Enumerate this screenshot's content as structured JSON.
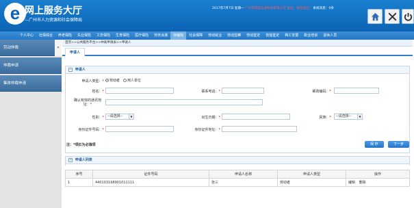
{
  "header": {
    "logo_title": "网上服务大厅",
    "logo_sub": "—广州市人力资源和社会保障局",
    "date_text": "2017年7月7日 星期一",
    "company_text": "广州市新盈信通科技有限公司",
    "link_text": "退出，请您退出！",
    "system_text": "系统消息：0条"
  },
  "nav": {
    "items": [
      "个人中心",
      "社保综合",
      "养老保险",
      "失业保险",
      "工伤保险",
      "生育保险",
      "医疗保险",
      "劳务派遣",
      "仲裁院",
      "社会保障",
      "劳动就业",
      "劳动监察",
      "劳动鉴定",
      "技能鉴定",
      "档工安置",
      "职业培训",
      "退休人员"
    ],
    "active_index": 8
  },
  "sidebar": {
    "items": [
      "劳动仲裁",
      "仲裁申请",
      "集体仲裁申请"
    ],
    "collapse": "«"
  },
  "breadcrumb": "首页>>公共服务平台>>仲裁申请表>>申请人",
  "tab": "申请人",
  "form": {
    "section_title": "申请人",
    "applicant_type_label": "申请人类型：",
    "applicant_type_options": [
      "劳动者",
      "用人单位"
    ],
    "name_label": "姓名：",
    "phone_label": "联系电话：",
    "postcode_label": "邮政编码：",
    "address_label": "确认有效的通讯地址：",
    "gender_label": "性别：",
    "gender_value": "--请选择--",
    "birth_label": "出生日期：",
    "ethnic_label": "民族：",
    "ethnic_value": "--请选择--",
    "id_label": "身份证件号码：",
    "id_address_label": "身份证件地址：",
    "note": "注：*项红为必填项",
    "save_button": "保 存",
    "next_button": "下一步"
  },
  "list": {
    "section_title": "申请人列表",
    "columns": [
      "序号",
      "证件号码",
      "申请人名称",
      "申请人类型",
      "操作"
    ],
    "rows": [
      {
        "no": "1",
        "id": "440103198901011111",
        "name": "张三",
        "type": "劳动者",
        "edit": "编辑",
        "delete": "删除"
      }
    ]
  }
}
